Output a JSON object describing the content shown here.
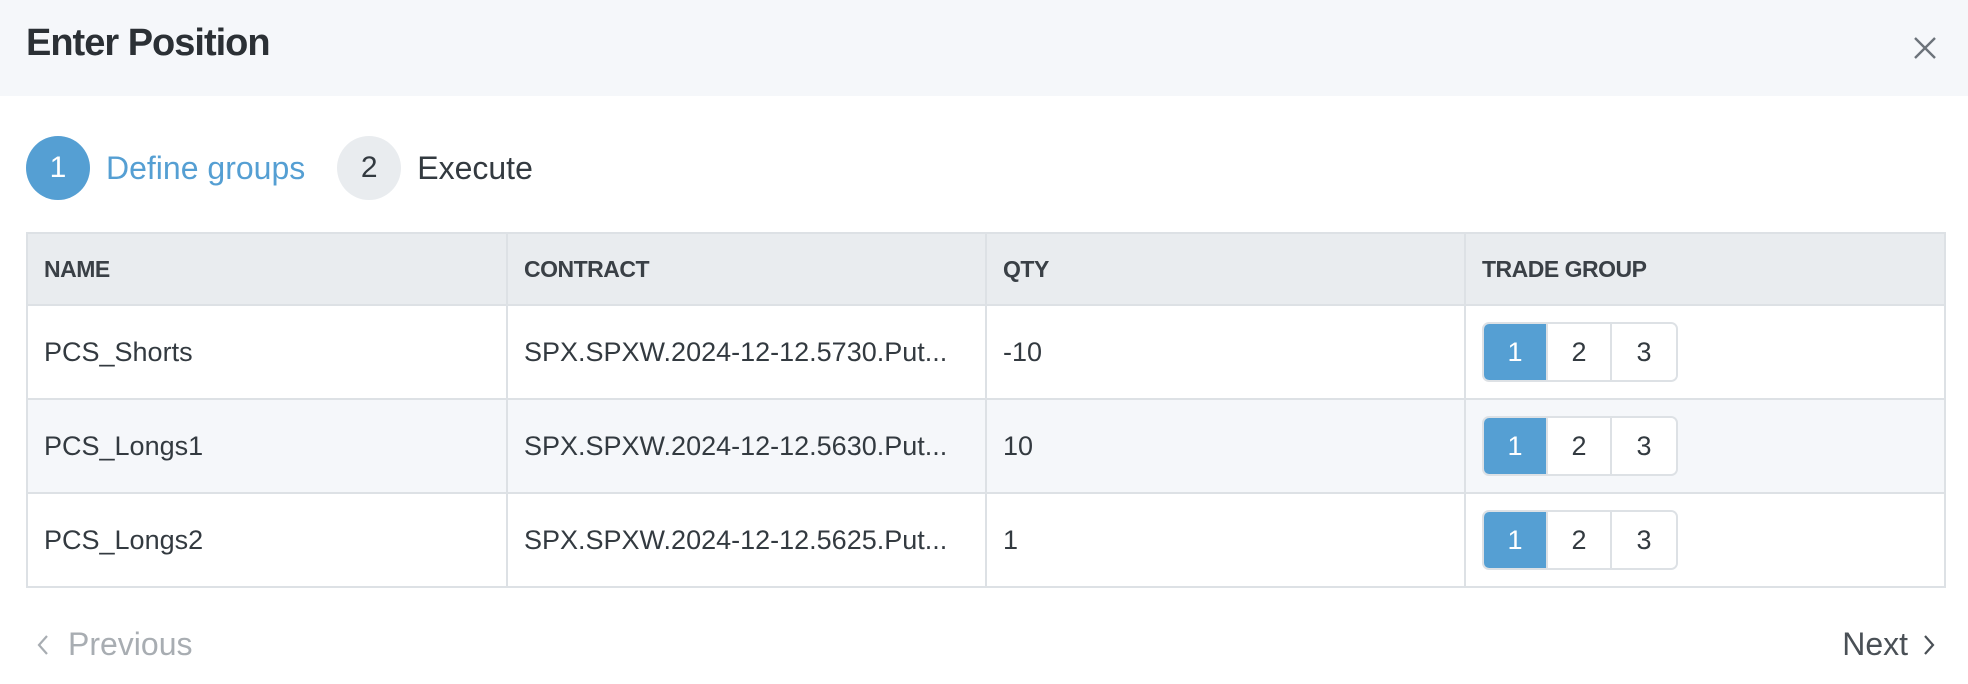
{
  "modal": {
    "title": "Enter Position",
    "close_icon": "close-icon"
  },
  "steps": [
    {
      "number": "1",
      "label": "Define groups",
      "state": "active"
    },
    {
      "number": "2",
      "label": "Execute",
      "state": "inactive"
    }
  ],
  "table": {
    "columns": [
      "NAME",
      "CONTRACT",
      "QTY",
      "TRADE GROUP"
    ],
    "group_options": [
      "1",
      "2",
      "3"
    ],
    "rows": [
      {
        "name": "PCS_Shorts",
        "contract": "SPX.SPXW.2024-12-12.5730.Put...",
        "qty": "-10",
        "trade_group": "1"
      },
      {
        "name": "PCS_Longs1",
        "contract": "SPX.SPXW.2024-12-12.5630.Put...",
        "qty": "10",
        "trade_group": "1"
      },
      {
        "name": "PCS_Longs2",
        "contract": "SPX.SPXW.2024-12-12.5625.Put...",
        "qty": "1",
        "trade_group": "1"
      }
    ]
  },
  "footer": {
    "previous_label": "Previous",
    "next_label": "Next",
    "previous_icon": "chevron-left-icon",
    "next_icon": "chevron-right-icon"
  },
  "colors": {
    "accent": "#559fd3",
    "header_bg": "#f5f7fa",
    "table_header_bg": "#e9ecef",
    "border": "#dde1e5",
    "disabled_text": "#a8adb2"
  }
}
